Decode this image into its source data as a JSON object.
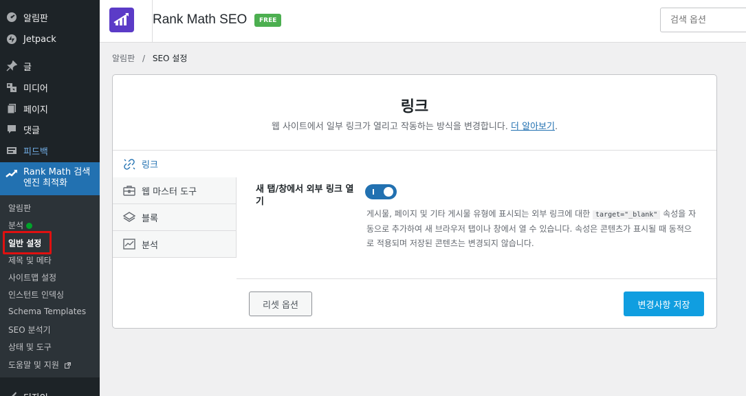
{
  "sidebar": {
    "items": [
      {
        "label": "알림판",
        "icon": "dashboard-icon"
      },
      {
        "label": "Jetpack",
        "icon": "jetpack-icon"
      },
      {
        "label": "글",
        "icon": "pin-icon"
      },
      {
        "label": "미디어",
        "icon": "media-icon"
      },
      {
        "label": "페이지",
        "icon": "pages-icon"
      },
      {
        "label": "댓글",
        "icon": "comments-icon"
      },
      {
        "label": "피드백",
        "icon": "feedback-icon"
      }
    ],
    "current": {
      "label_line1": "Rank Math 검색",
      "label_line2": "엔진 최적화",
      "icon": "rank-math-icon"
    },
    "submenu": [
      "알림판",
      "분석",
      "일반 설정",
      "제목 및 메타",
      "사이트맵 설정",
      "인스턴트 인덱싱",
      "Schema Templates",
      "SEO 분석기",
      "상태 및 도구",
      "도움말 및 지원"
    ],
    "next_item": "디자인"
  },
  "header": {
    "title": "Rank Math SEO",
    "badge": "FREE",
    "search_placeholder": "검색 옵션"
  },
  "breadcrumb": {
    "home": "알림판",
    "separator": "/",
    "current": "SEO 설정"
  },
  "card": {
    "title": "링크",
    "description": "웹 사이트에서 일부 링크가 열리고 작동하는 방식을 변경합니다.",
    "learn_more": "더 알아보기",
    "period": "."
  },
  "tabs": [
    {
      "label": "링크",
      "icon": "link-icon",
      "active": true
    },
    {
      "label": "웹 마스터 도구",
      "icon": "briefcase-icon",
      "active": false
    },
    {
      "label": "블록",
      "icon": "layers-icon",
      "active": false
    },
    {
      "label": "분석",
      "icon": "chart-icon",
      "active": false
    }
  ],
  "setting": {
    "label": "새 탭/창에서 외부 링크 열기",
    "enabled": true,
    "desc_before": "게시물, 페이지 및 기타 게시물 유형에 표시되는 외부 링크에 대한",
    "code": "target=\"_blank\"",
    "desc_after": "속성을 자동으로 추가하여 새 브라우저 탭이나 창에서 열 수 있습니다. 속성은 콘텐츠가 표시될 때 동적으로 적용되며 저장된 콘텐츠는 변경되지 않습니다."
  },
  "buttons": {
    "reset": "리셋 옵션",
    "save": "변경사항 저장"
  },
  "colors": {
    "sidebar_bg": "#1d2327",
    "accent": "#2271b1",
    "save_button": "#109ee0",
    "badge": "#4caf50",
    "logo": "#5b3bc7",
    "highlight_box": "#e01010"
  }
}
